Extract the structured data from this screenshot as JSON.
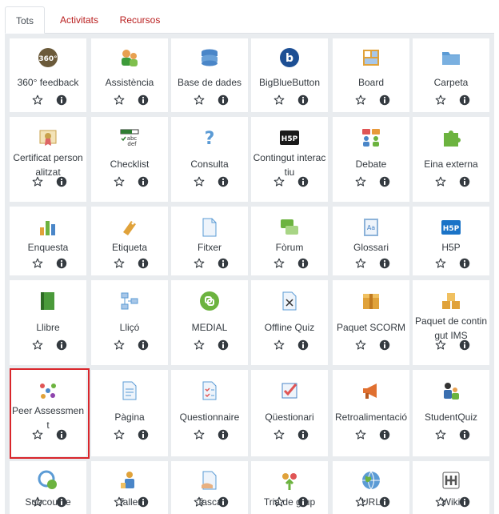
{
  "tabs": [
    {
      "label": "Tots",
      "active": true
    },
    {
      "label": "Activitats",
      "active": false
    },
    {
      "label": "Recursos",
      "active": false
    }
  ],
  "rows": [
    [
      {
        "label": "360° feedback",
        "icon": "360-feedback-icon",
        "color": "#6b5a3a"
      },
      {
        "label": "Assistència",
        "icon": "attendance-icon",
        "color": "#3d9b3a"
      },
      {
        "label": "Base de dades",
        "icon": "database-icon",
        "color": "#4a86c8"
      },
      {
        "label": "BigBlueButton",
        "icon": "bigbluebutton-icon",
        "color": "#1d4f94"
      },
      {
        "label": "Board",
        "icon": "board-icon",
        "color": "#e0a23a"
      },
      {
        "label": "Carpeta",
        "icon": "folder-icon",
        "color": "#5b9bd5"
      }
    ],
    [
      {
        "label": "Certificat personalitzat",
        "icon": "certificate-icon",
        "color": "#c9a14b"
      },
      {
        "label": "Checklist",
        "icon": "checklist-icon",
        "color": "#2e7d32"
      },
      {
        "label": "Consulta",
        "icon": "question-icon",
        "color": "#5b9bd5"
      },
      {
        "label": "Contingut interactiu",
        "icon": "h5p-black-icon",
        "color": "#1a1a1a"
      },
      {
        "label": "Debate",
        "icon": "debate-icon",
        "color": "#e05555"
      },
      {
        "label": "Eina externa",
        "icon": "puzzle-icon",
        "color": "#6cb33f"
      }
    ],
    [
      {
        "label": "Enquesta",
        "icon": "chart-icon",
        "color": "#6cb33f"
      },
      {
        "label": "Etiqueta",
        "icon": "label-icon",
        "color": "#e0a23a"
      },
      {
        "label": "Fitxer",
        "icon": "file-icon",
        "color": "#5b9bd5"
      },
      {
        "label": "Fòrum",
        "icon": "forum-icon",
        "color": "#6cb33f"
      },
      {
        "label": "Glossari",
        "icon": "glossary-icon",
        "color": "#8db3d9"
      },
      {
        "label": "H5P",
        "icon": "h5p-blue-icon",
        "color": "#1a73c7"
      }
    ],
    [
      {
        "label": "Llibre",
        "icon": "book-icon",
        "color": "#4a9a3a"
      },
      {
        "label": "Lliçó",
        "icon": "lesson-icon",
        "color": "#5b9bd5"
      },
      {
        "label": "MEDIAL",
        "icon": "medial-icon",
        "color": "#6cb33f"
      },
      {
        "label": "Offline Quiz",
        "icon": "offline-quiz-icon",
        "color": "#5b9bd5"
      },
      {
        "label": "Paquet SCORM",
        "icon": "scorm-icon",
        "color": "#e0a23a"
      },
      {
        "label": "Paquet de contingut IMS",
        "icon": "ims-package-icon",
        "color": "#e0a23a"
      }
    ],
    [
      {
        "label": "Peer Assessment",
        "icon": "peer-assessment-icon",
        "color": "#e05555"
      },
      {
        "label": "Pàgina",
        "icon": "page-icon",
        "color": "#5b9bd5"
      },
      {
        "label": "Questionnaire",
        "icon": "questionnaire-icon",
        "color": "#5b9bd5"
      },
      {
        "label": "Qüestionari",
        "icon": "quiz-icon",
        "color": "#e05555"
      },
      {
        "label": "Retroalimentació",
        "icon": "feedback-megaphone-icon",
        "color": "#e07030"
      },
      {
        "label": "StudentQuiz",
        "icon": "studentquiz-icon",
        "color": "#3a6fb0"
      }
    ],
    [
      {
        "label": "Subcourse",
        "icon": "subcourse-icon",
        "color": "#5b9bd5"
      },
      {
        "label": "Taller",
        "icon": "workshop-icon",
        "color": "#e0a23a"
      },
      {
        "label": "Tasca",
        "icon": "assignment-icon",
        "color": "#5b9bd5"
      },
      {
        "label": "Tria de grup",
        "icon": "group-choice-icon",
        "color": "#6cb33f"
      },
      {
        "label": "URL",
        "icon": "url-icon",
        "color": "#5b9bd5"
      },
      {
        "label": "Wiki",
        "icon": "wiki-icon",
        "color": "#555555"
      }
    ]
  ]
}
